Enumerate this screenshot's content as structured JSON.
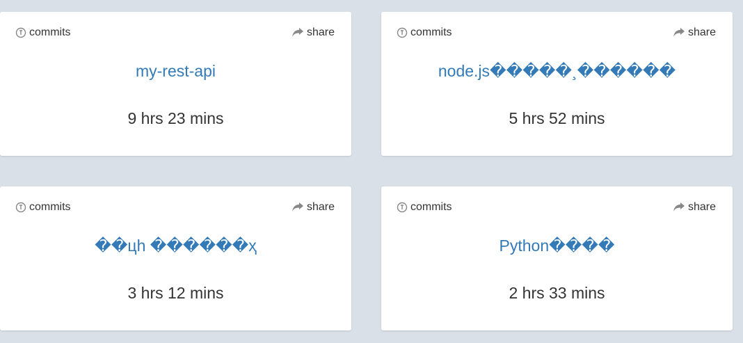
{
  "colors": {
    "background": "#d9e0e8",
    "card": "#ffffff",
    "link": "#337ab7",
    "text": "#333333",
    "icon": "#888888"
  },
  "cards": [
    {
      "commits_label": "commits",
      "commits_icon": "commits-clock-icon",
      "share_label": "share",
      "share_icon": "share-arrow-icon",
      "project": "my-rest-api",
      "time": "9 hrs 23 mins"
    },
    {
      "commits_label": "commits",
      "commits_icon": "commits-clock-icon",
      "share_label": "share",
      "share_icon": "share-arrow-icon",
      "project": "node.js�����¸������",
      "time": "5 hrs 52 mins"
    },
    {
      "commits_label": "commits",
      "commits_icon": "commits-clock-icon",
      "share_label": "share",
      "share_icon": "share-arrow-icon",
      "project": "��цh ������ҳ",
      "time": "3 hrs 12 mins"
    },
    {
      "commits_label": "commits",
      "commits_icon": "commits-clock-icon",
      "share_label": "share",
      "share_icon": "share-arrow-icon",
      "project": "Python����",
      "time": "2 hrs 33 mins"
    }
  ]
}
